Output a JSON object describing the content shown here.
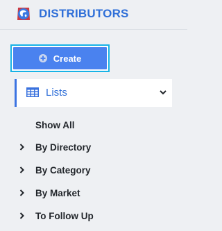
{
  "header": {
    "brand": "DISTRIBUTORS",
    "logo_icon": "globe-icon"
  },
  "actions": {
    "create_label": "Create",
    "create_icon": "plus-circle-icon"
  },
  "lists": {
    "label": "Lists",
    "icon": "grid-table-icon",
    "toggle_icon": "chevron-down-icon"
  },
  "nav": {
    "show_all": "Show All",
    "items": [
      {
        "label": "By Directory"
      },
      {
        "label": "By Category"
      },
      {
        "label": "By Market"
      },
      {
        "label": "To Follow Up"
      }
    ]
  },
  "colors": {
    "accent": "#2f6fd8",
    "button": "#4a82ef",
    "focus_ring": "#17b3e6"
  }
}
